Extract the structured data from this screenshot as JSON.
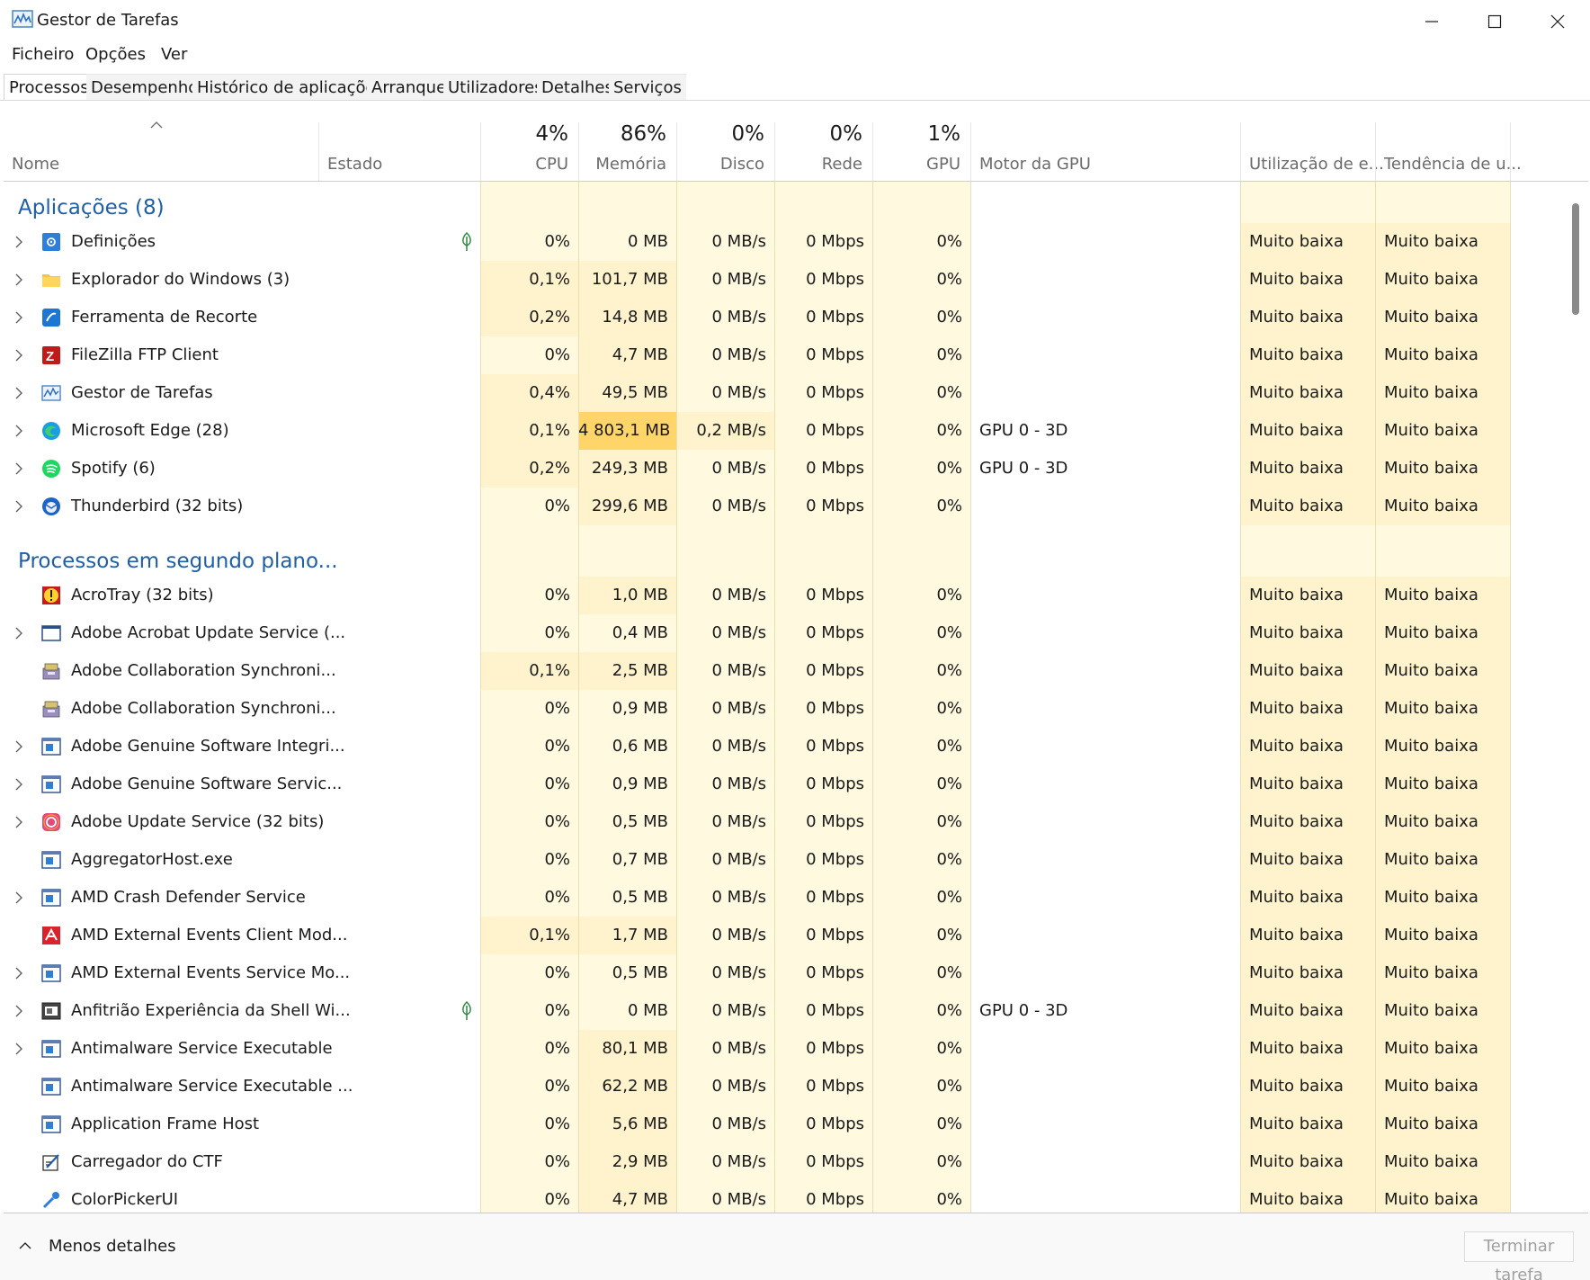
{
  "window": {
    "title": "Gestor de Tarefas"
  },
  "menu": [
    "Ficheiro",
    "Opções",
    "Ver"
  ],
  "tabs": [
    "Processos",
    "Desempenho",
    "Histórico de aplicações",
    "Arranque",
    "Utilizadores",
    "Detalhes",
    "Serviços"
  ],
  "columns": {
    "name": "Nome",
    "status": "Estado",
    "cpu": {
      "pct": "4%",
      "label": "CPU"
    },
    "memory": {
      "pct": "86%",
      "label": "Memória"
    },
    "disk": {
      "pct": "0%",
      "label": "Disco"
    },
    "network": {
      "pct": "0%",
      "label": "Rede"
    },
    "gpu": {
      "pct": "1%",
      "label": "GPU"
    },
    "gpu_engine": "Motor da GPU",
    "power_usage": "Utilização de e...",
    "power_trend": "Tendência de u..."
  },
  "groups": [
    {
      "title": "Aplicações (8)",
      "rows": [
        {
          "icon": "settings-icon",
          "name": "Definições",
          "expand": true,
          "leaf": true,
          "cpu": "0%",
          "mem": "0 MB",
          "disk": "0 MB/s",
          "net": "0 Mbps",
          "gpu": "0%",
          "engine": "",
          "power": "Muito baixa",
          "trend": "Muito baixa",
          "cpu_heat": 0,
          "mem_heat": 0
        },
        {
          "icon": "folder-icon",
          "name": "Explorador do Windows (3)",
          "expand": true,
          "leaf": false,
          "cpu": "0,1%",
          "mem": "101,7 MB",
          "disk": "0 MB/s",
          "net": "0 Mbps",
          "gpu": "0%",
          "engine": "",
          "power": "Muito baixa",
          "trend": "Muito baixa",
          "cpu_heat": 1,
          "mem_heat": 1
        },
        {
          "icon": "snip-icon",
          "name": "Ferramenta de Recorte",
          "expand": true,
          "leaf": false,
          "cpu": "0,2%",
          "mem": "14,8 MB",
          "disk": "0 MB/s",
          "net": "0 Mbps",
          "gpu": "0%",
          "engine": "",
          "power": "Muito baixa",
          "trend": "Muito baixa",
          "cpu_heat": 1,
          "mem_heat": 1
        },
        {
          "icon": "filezilla-icon",
          "name": "FileZilla FTP Client",
          "expand": true,
          "leaf": false,
          "cpu": "0%",
          "mem": "4,7 MB",
          "disk": "0 MB/s",
          "net": "0 Mbps",
          "gpu": "0%",
          "engine": "",
          "power": "Muito baixa",
          "trend": "Muito baixa",
          "cpu_heat": 0,
          "mem_heat": 1
        },
        {
          "icon": "taskmgr-icon",
          "name": "Gestor de Tarefas",
          "expand": true,
          "leaf": false,
          "cpu": "0,4%",
          "mem": "49,5 MB",
          "disk": "0 MB/s",
          "net": "0 Mbps",
          "gpu": "0%",
          "engine": "",
          "power": "Muito baixa",
          "trend": "Muito baixa",
          "cpu_heat": 1,
          "mem_heat": 1
        },
        {
          "icon": "edge-icon",
          "name": "Microsoft Edge (28)",
          "expand": true,
          "leaf": false,
          "cpu": "0,1%",
          "mem": "4 803,1 MB",
          "disk": "0,2 MB/s",
          "net": "0 Mbps",
          "gpu": "0%",
          "engine": "GPU 0 - 3D",
          "power": "Muito baixa",
          "trend": "Muito baixa",
          "cpu_heat": 1,
          "mem_heat": 3,
          "disk_heat": 1
        },
        {
          "icon": "spotify-icon",
          "name": "Spotify (6)",
          "expand": true,
          "leaf": false,
          "cpu": "0,2%",
          "mem": "249,3 MB",
          "disk": "0 MB/s",
          "net": "0 Mbps",
          "gpu": "0%",
          "engine": "GPU 0 - 3D",
          "power": "Muito baixa",
          "trend": "Muito baixa",
          "cpu_heat": 1,
          "mem_heat": 1
        },
        {
          "icon": "thunderbird-icon",
          "name": "Thunderbird (32 bits)",
          "expand": true,
          "leaf": false,
          "cpu": "0%",
          "mem": "299,6 MB",
          "disk": "0 MB/s",
          "net": "0 Mbps",
          "gpu": "0%",
          "engine": "",
          "power": "Muito baixa",
          "trend": "Muito baixa",
          "cpu_heat": 0,
          "mem_heat": 1
        }
      ]
    },
    {
      "title": "Processos em segundo plano...",
      "rows": [
        {
          "icon": "acrotray-icon",
          "name": "AcroTray (32 bits)",
          "expand": false,
          "leaf": false,
          "cpu": "0%",
          "mem": "1,0 MB",
          "disk": "0 MB/s",
          "net": "0 Mbps",
          "gpu": "0%",
          "engine": "",
          "power": "Muito baixa",
          "trend": "Muito baixa",
          "cpu_heat": 0,
          "mem_heat": 1
        },
        {
          "icon": "window-icon",
          "name": "Adobe Acrobat Update Service (...",
          "expand": true,
          "leaf": false,
          "cpu": "0%",
          "mem": "0,4 MB",
          "disk": "0 MB/s",
          "net": "0 Mbps",
          "gpu": "0%",
          "engine": "",
          "power": "Muito baixa",
          "trend": "Muito baixa",
          "cpu_heat": 0,
          "mem_heat": 0
        },
        {
          "icon": "adobe-sync-icon",
          "name": "Adobe Collaboration Synchroni...",
          "expand": false,
          "leaf": false,
          "cpu": "0,1%",
          "mem": "2,5 MB",
          "disk": "0 MB/s",
          "net": "0 Mbps",
          "gpu": "0%",
          "engine": "",
          "power": "Muito baixa",
          "trend": "Muito baixa",
          "cpu_heat": 1,
          "mem_heat": 1
        },
        {
          "icon": "adobe-sync-icon",
          "name": "Adobe Collaboration Synchroni...",
          "expand": false,
          "leaf": false,
          "cpu": "0%",
          "mem": "0,9 MB",
          "disk": "0 MB/s",
          "net": "0 Mbps",
          "gpu": "0%",
          "engine": "",
          "power": "Muito baixa",
          "trend": "Muito baixa",
          "cpu_heat": 0,
          "mem_heat": 0
        },
        {
          "icon": "service-icon",
          "name": "Adobe Genuine Software Integri...",
          "expand": true,
          "leaf": false,
          "cpu": "0%",
          "mem": "0,6 MB",
          "disk": "0 MB/s",
          "net": "0 Mbps",
          "gpu": "0%",
          "engine": "",
          "power": "Muito baixa",
          "trend": "Muito baixa",
          "cpu_heat": 0,
          "mem_heat": 0
        },
        {
          "icon": "service-icon",
          "name": "Adobe Genuine Software Servic...",
          "expand": true,
          "leaf": false,
          "cpu": "0%",
          "mem": "0,9 MB",
          "disk": "0 MB/s",
          "net": "0 Mbps",
          "gpu": "0%",
          "engine": "",
          "power": "Muito baixa",
          "trend": "Muito baixa",
          "cpu_heat": 0,
          "mem_heat": 0
        },
        {
          "icon": "adobe-cc-icon",
          "name": "Adobe Update Service (32 bits)",
          "expand": true,
          "leaf": false,
          "cpu": "0%",
          "mem": "0,5 MB",
          "disk": "0 MB/s",
          "net": "0 Mbps",
          "gpu": "0%",
          "engine": "",
          "power": "Muito baixa",
          "trend": "Muito baixa",
          "cpu_heat": 0,
          "mem_heat": 0
        },
        {
          "icon": "service-icon",
          "name": "AggregatorHost.exe",
          "expand": false,
          "leaf": false,
          "cpu": "0%",
          "mem": "0,7 MB",
          "disk": "0 MB/s",
          "net": "0 Mbps",
          "gpu": "0%",
          "engine": "",
          "power": "Muito baixa",
          "trend": "Muito baixa",
          "cpu_heat": 0,
          "mem_heat": 0
        },
        {
          "icon": "service-icon",
          "name": "AMD Crash Defender Service",
          "expand": true,
          "leaf": false,
          "cpu": "0%",
          "mem": "0,5 MB",
          "disk": "0 MB/s",
          "net": "0 Mbps",
          "gpu": "0%",
          "engine": "",
          "power": "Muito baixa",
          "trend": "Muito baixa",
          "cpu_heat": 0,
          "mem_heat": 0
        },
        {
          "icon": "amd-icon",
          "name": "AMD External Events Client Mod...",
          "expand": false,
          "leaf": false,
          "cpu": "0,1%",
          "mem": "1,7 MB",
          "disk": "0 MB/s",
          "net": "0 Mbps",
          "gpu": "0%",
          "engine": "",
          "power": "Muito baixa",
          "trend": "Muito baixa",
          "cpu_heat": 1,
          "mem_heat": 1
        },
        {
          "icon": "service-icon",
          "name": "AMD External Events Service Mo...",
          "expand": true,
          "leaf": false,
          "cpu": "0%",
          "mem": "0,5 MB",
          "disk": "0 MB/s",
          "net": "0 Mbps",
          "gpu": "0%",
          "engine": "",
          "power": "Muito baixa",
          "trend": "Muito baixa",
          "cpu_heat": 0,
          "mem_heat": 0
        },
        {
          "icon": "shell-icon",
          "name": "Anfitrião Experiência da Shell Wi...",
          "expand": true,
          "leaf": true,
          "cpu": "0%",
          "mem": "0 MB",
          "disk": "0 MB/s",
          "net": "0 Mbps",
          "gpu": "0%",
          "engine": "GPU 0 - 3D",
          "power": "Muito baixa",
          "trend": "Muito baixa",
          "cpu_heat": 0,
          "mem_heat": 0
        },
        {
          "icon": "service-icon",
          "name": "Antimalware Service Executable",
          "expand": true,
          "leaf": false,
          "cpu": "0%",
          "mem": "80,1 MB",
          "disk": "0 MB/s",
          "net": "0 Mbps",
          "gpu": "0%",
          "engine": "",
          "power": "Muito baixa",
          "trend": "Muito baixa",
          "cpu_heat": 0,
          "mem_heat": 1
        },
        {
          "icon": "service-icon",
          "name": "Antimalware Service Executable ...",
          "expand": false,
          "leaf": false,
          "cpu": "0%",
          "mem": "62,2 MB",
          "disk": "0 MB/s",
          "net": "0 Mbps",
          "gpu": "0%",
          "engine": "",
          "power": "Muito baixa",
          "trend": "Muito baixa",
          "cpu_heat": 0,
          "mem_heat": 1
        },
        {
          "icon": "service-icon",
          "name": "Application Frame Host",
          "expand": false,
          "leaf": false,
          "cpu": "0%",
          "mem": "5,6 MB",
          "disk": "0 MB/s",
          "net": "0 Mbps",
          "gpu": "0%",
          "engine": "",
          "power": "Muito baixa",
          "trend": "Muito baixa",
          "cpu_heat": 0,
          "mem_heat": 1
        },
        {
          "icon": "ctf-icon",
          "name": "Carregador do CTF",
          "expand": false,
          "leaf": false,
          "cpu": "0%",
          "mem": "2,9 MB",
          "disk": "0 MB/s",
          "net": "0 Mbps",
          "gpu": "0%",
          "engine": "",
          "power": "Muito baixa",
          "trend": "Muito baixa",
          "cpu_heat": 0,
          "mem_heat": 1
        },
        {
          "icon": "colorpicker-icon",
          "name": "ColorPickerUI",
          "expand": false,
          "leaf": false,
          "cpu": "0%",
          "mem": "4,7 MB",
          "disk": "0 MB/s",
          "net": "0 Mbps",
          "gpu": "0%",
          "engine": "",
          "power": "Muito baixa",
          "trend": "Muito baixa",
          "cpu_heat": 0,
          "mem_heat": 1
        }
      ]
    }
  ],
  "footer": {
    "less_details": "Menos detalhes",
    "end_task": "Terminar tarefa"
  },
  "colors": {
    "heat0": "#fff9e0",
    "heat1": "#fff3cd",
    "heat3": "#ffd56a",
    "accent": "#1f5fa6"
  }
}
